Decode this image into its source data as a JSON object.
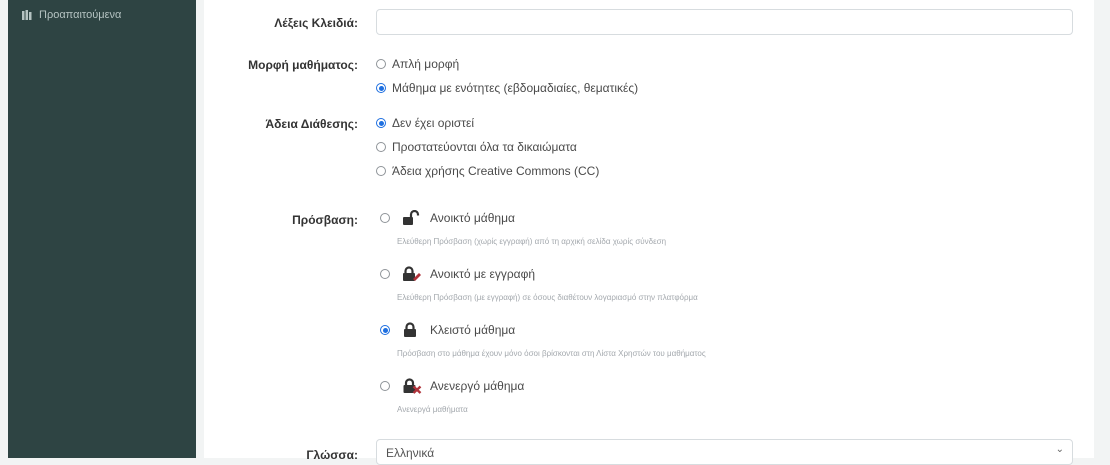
{
  "sidebar": {
    "item_label": "Προαπαιτούμενα",
    "item_icon": "books-icon"
  },
  "form": {
    "keywords_label": "Λέξεις Κλειδιά:",
    "keywords_value": "",
    "format": {
      "label": "Μορφή μαθήματος:",
      "options": [
        "Απλή μορφή",
        "Μάθημα με ενότητες (εβδομαδιαίες, θεματικές)"
      ],
      "selected": "Μάθημα με ενότητες (εβδομαδιαίες, θεματικές)"
    },
    "license": {
      "label": "Άδεια Διάθεσης:",
      "options": [
        "Δεν έχει οριστεί",
        "Προστατεύονται όλα τα δικαιώματα",
        "Άδεια χρήσης Creative Commons (CC)"
      ],
      "selected": "Δεν έχει οριστεί"
    },
    "access": {
      "label": "Πρόσβαση:",
      "options": [
        {
          "label": "Ανοικτό μάθημα",
          "help": "Ελεύθερη Πρόσβαση (χωρίς εγγραφή) από τη αρχική σελίδα χωρίς σύνδεση",
          "icon": "unlocked-padlock-icon"
        },
        {
          "label": "Ανοικτό με εγγραφή",
          "help": "Ελεύθερη Πρόσβαση (με εγγραφή) σε όσους διαθέτουν λογαριασμό στην πλατφόρμα",
          "icon": "lock-with-pencil-icon"
        },
        {
          "label": "Κλειστό μάθημα",
          "help": "Πρόσβαση στο μάθημα έχουν μόνο όσοι βρίσκονται στη Λίστα Χρηστών του μαθήματος",
          "icon": "locked-padlock-icon"
        },
        {
          "label": "Ανενεργό μάθημα",
          "help": "Ανενεργά μαθήματα",
          "icon": "disabled-lock-icon"
        }
      ],
      "selected": "Κλειστό μάθημα"
    },
    "language": {
      "label": "Γλώσσα:",
      "value": "Ελληνικά"
    }
  },
  "colors": {
    "sidebar_bg": "#2e4443",
    "radio_selected": "#1e6fe0",
    "icon_dark": "#333333",
    "icon_accent": "#b0333b"
  }
}
